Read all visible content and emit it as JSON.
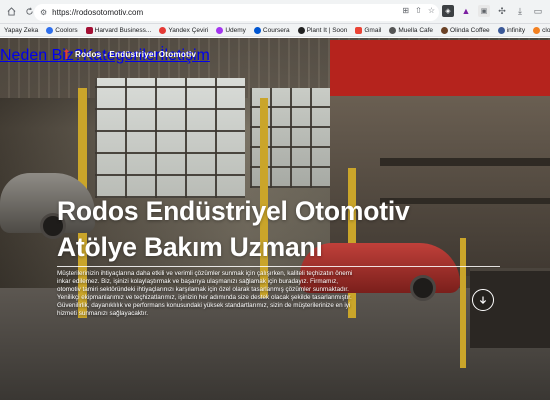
{
  "browser": {
    "url": "https://rodosotomotiv.com",
    "bookmarks": [
      {
        "label": "Yapay Zeka",
        "color": ""
      },
      {
        "label": "Coolors",
        "color": "#2f6fed"
      },
      {
        "label": "Harvard Business...",
        "color": "#a41034"
      },
      {
        "label": "Yandex Çeviri",
        "color": "#e53935"
      },
      {
        "label": "Udemy",
        "color": "#a435f0"
      },
      {
        "label": "Coursera",
        "color": "#0056d2"
      },
      {
        "label": "Plant It | Soon",
        "color": "#222222"
      },
      {
        "label": "Gmail",
        "color": "#ea4335"
      },
      {
        "label": "Muella Cafe",
        "color": "#555555"
      },
      {
        "label": "Olinda Coffee",
        "color": "#6b4226"
      },
      {
        "label": "infinity",
        "color": "#3b5998"
      },
      {
        "label": "cloudflare",
        "color": "#f38020"
      }
    ]
  },
  "site": {
    "brand": "Rodos - Endüstriyel Otomotiv",
    "nav": {
      "why": "Neden Biz?",
      "categories": "Kategoriler",
      "contact": "İletişim"
    },
    "hero": {
      "title_line1": "Rodos Endüstriyel Otomotiv",
      "title_line2": "Atölye Bakım Uzmanı",
      "text": "Müşterilerinizin ihtiyaçlarına daha etkili ve verimli çözümler sunmak için çalışırken, kaliteli teçhizatın önemi inkar edilemez. Biz, işinizi kolaylaştırmak ve başarıya ulaşmanızı sağlamak için buradayız. Firmamız, otomotiv tamiri sektöründeki ihtiyaçlarınızı karşılamak için özel olarak tasarlanmış çözümler sunmaktadır. Yenilikçi ekipmanlarımız ve teçhizatlarımız, işinizin her adımında size destek olacak şekilde tasarlanmıştır. Güvenilirlik, dayanıklılık ve performans konusundaki yüksek standartlarımız, sizin de müşterilerinize en iyi hizmeti sunmanızı sağlayacaktır."
    }
  }
}
